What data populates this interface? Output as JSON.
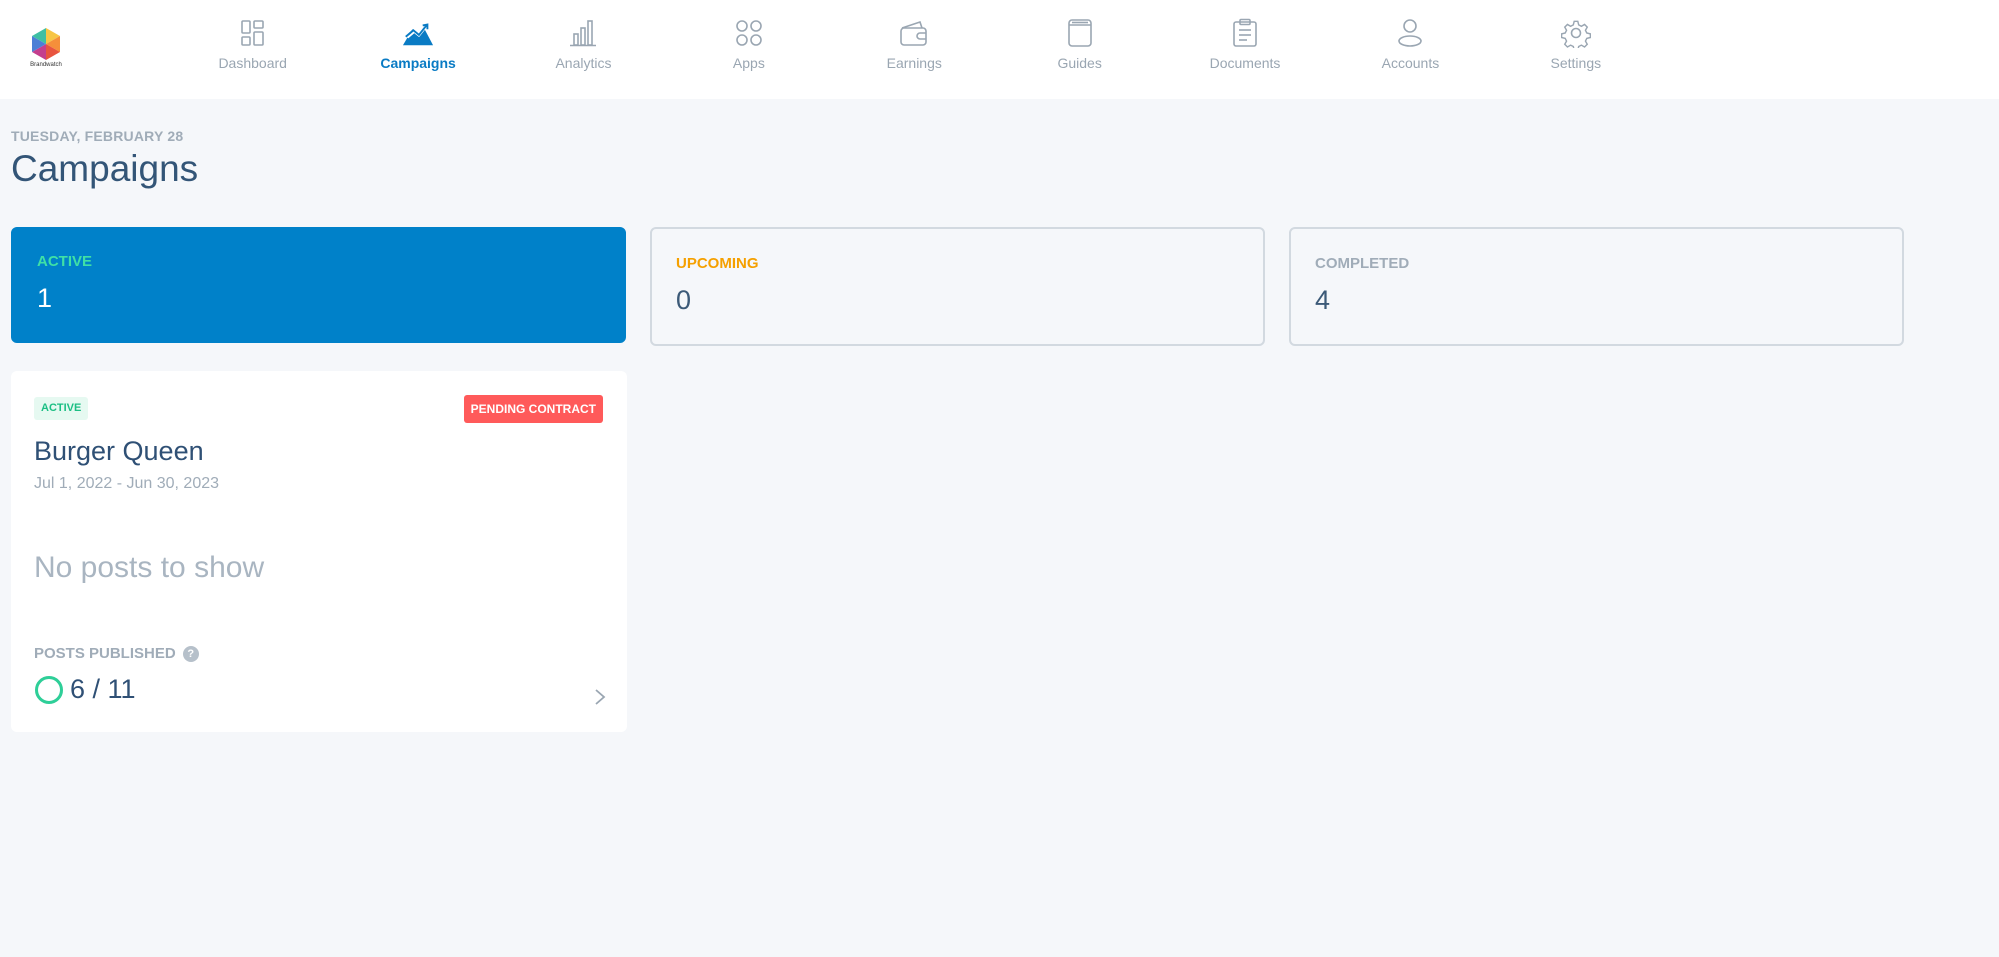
{
  "app": {
    "logo_text": "Brandwatch"
  },
  "nav": {
    "items": [
      {
        "label": "Dashboard",
        "icon": "dashboard-icon",
        "active": false
      },
      {
        "label": "Campaigns",
        "icon": "campaigns-icon",
        "active": true
      },
      {
        "label": "Analytics",
        "icon": "analytics-icon",
        "active": false
      },
      {
        "label": "Apps",
        "icon": "apps-icon",
        "active": false
      },
      {
        "label": "Earnings",
        "icon": "wallet-icon",
        "active": false
      },
      {
        "label": "Guides",
        "icon": "book-icon",
        "active": false
      },
      {
        "label": "Documents",
        "icon": "clipboard-icon",
        "active": false
      },
      {
        "label": "Accounts",
        "icon": "user-icon",
        "active": false
      },
      {
        "label": "Settings",
        "icon": "gear-icon",
        "active": false
      }
    ]
  },
  "header": {
    "date": "TUESDAY, FEBRUARY 28",
    "title": "Campaigns"
  },
  "stats": {
    "active": {
      "label": "ACTIVE",
      "value": "1"
    },
    "upcoming": {
      "label": "UPCOMING",
      "value": "0"
    },
    "completed": {
      "label": "COMPLETED",
      "value": "4"
    }
  },
  "campaign": {
    "status_badge": "ACTIVE",
    "contract_badge": "PENDING CONTRACT",
    "name": "Burger Queen",
    "dates": "Jul 1, 2022 - Jun 30, 2023",
    "empty_posts": "No posts to show",
    "posts_label": "POSTS PUBLISHED",
    "help_glyph": "?",
    "posts_count": "6 / 11",
    "posts_published": 6,
    "posts_total": 11
  },
  "colors": {
    "accent": "#0081c9",
    "nav_active": "#0a7bc4",
    "active_green": "#3fe0a6",
    "upcoming_orange": "#f5a000",
    "pending_red": "#ff5a5a",
    "ring_green": "#2ecf98"
  }
}
